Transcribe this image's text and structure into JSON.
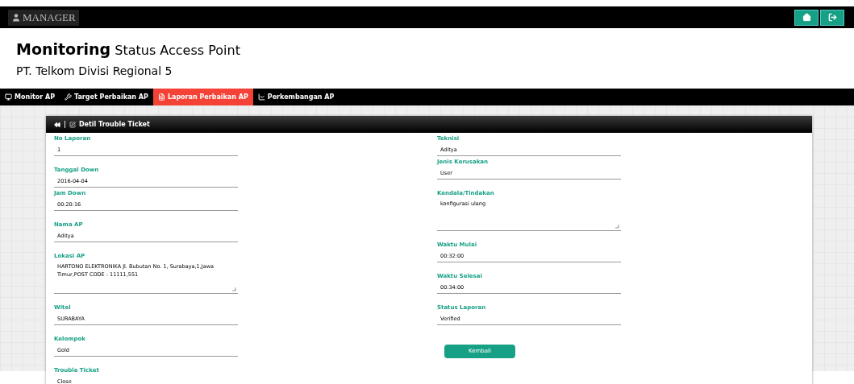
{
  "top_bar": {
    "brand": "MANAGER"
  },
  "header": {
    "title_bold": "Monitoring",
    "title_rest": "Status Access Point",
    "subtitle": "PT. Telkom Divisi Regional 5"
  },
  "nav": [
    {
      "label": "Monitor AP",
      "selected": false
    },
    {
      "label": "Target Perbaikan AP",
      "selected": false
    },
    {
      "label": "Laporan Perbaikan AP",
      "selected": true
    },
    {
      "label": "Perkembangan AP",
      "selected": false
    }
  ],
  "panel": {
    "separator": "|",
    "title": "Detil Trouble Ticket",
    "left_fields": [
      {
        "label": "No Laporan",
        "value": "1",
        "kind": "input"
      },
      {
        "label": "Tanggal Down",
        "value": "2016-04-04",
        "kind": "input"
      },
      {
        "label": "Jam Down",
        "value": "00:20:16",
        "kind": "input"
      },
      {
        "label": "Nama AP",
        "value": "Aditya",
        "kind": "input"
      },
      {
        "label": "Lokasi AP",
        "value": "HARTONO ELEKTRONIKA Jl. Bubutan No. 1, Surabaya,1,Jawa Timur,POST CODE : 11111,551",
        "kind": "textarea"
      },
      {
        "label": "Witel",
        "value": "SURABAYA",
        "kind": "input"
      },
      {
        "label": "Kelompok",
        "value": "Gold",
        "kind": "input"
      },
      {
        "label": "Trouble Ticket",
        "value": "Close",
        "kind": "input"
      }
    ],
    "right_fields": [
      {
        "label": "Teknisi",
        "value": "Aditya",
        "kind": "input"
      },
      {
        "label": "Jenis Kerusakan",
        "value": "User",
        "kind": "input"
      },
      {
        "label": "Kendala/Tindakan",
        "value": "konfigurasi ulang",
        "kind": "textarea"
      },
      {
        "label": "Waktu Mulai",
        "value": "00:32:00",
        "kind": "input"
      },
      {
        "label": "Waktu Selesai",
        "value": "00:34:00",
        "kind": "input"
      },
      {
        "label": "Status Laporan",
        "value": "Verified",
        "kind": "input"
      }
    ],
    "button": "Kembali"
  }
}
